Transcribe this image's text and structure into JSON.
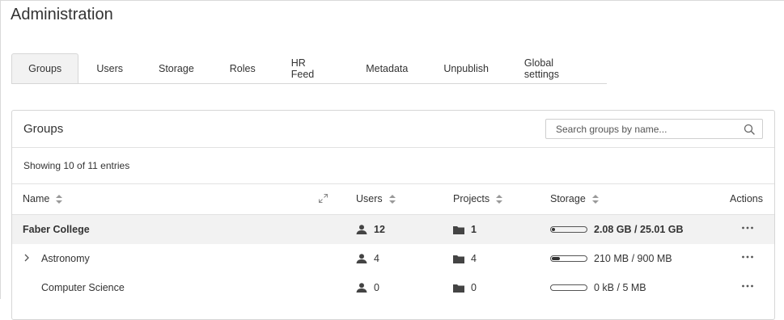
{
  "page_title": "Administration",
  "tabs": [
    {
      "label": "Groups"
    },
    {
      "label": "Users"
    },
    {
      "label": "Storage"
    },
    {
      "label": "Roles"
    },
    {
      "label": "HR Feed"
    },
    {
      "label": "Metadata"
    },
    {
      "label": "Unpublish"
    },
    {
      "label": "Global settings"
    }
  ],
  "active_tab": "Groups",
  "panel": {
    "title": "Groups",
    "search_placeholder": "Search groups by name...",
    "showing_text": "Showing 10 of 11 entries"
  },
  "table": {
    "columns": {
      "name": "Name",
      "users": "Users",
      "projects": "Projects",
      "storage": "Storage",
      "actions": "Actions"
    },
    "rows": [
      {
        "name": "Faber College",
        "users": "12",
        "projects": "1",
        "storage_used": "2.08 GB",
        "storage_sep": "/",
        "storage_total": "25.01 GB",
        "usage_fraction": 0.083
      },
      {
        "name": "Astronomy",
        "users": "4",
        "projects": "4",
        "storage_used": "210 MB",
        "storage_sep": "/",
        "storage_total": "900 MB",
        "usage_fraction": 0.233
      },
      {
        "name": "Computer Science",
        "users": "0",
        "projects": "0",
        "storage_used": "0 kB",
        "storage_sep": "/",
        "storage_total": "5 MB",
        "usage_fraction": 0.0
      }
    ]
  },
  "colors": {
    "accent_bg": "#f2f2f2",
    "border": "#d6d6d6",
    "text": "#333333"
  }
}
